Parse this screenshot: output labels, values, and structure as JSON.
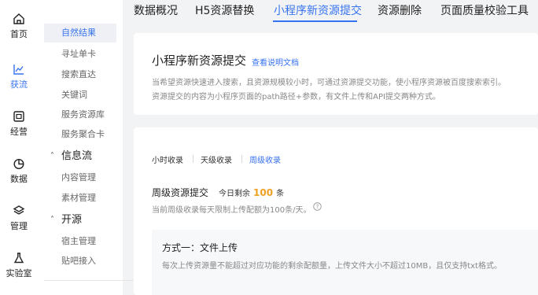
{
  "rail": {
    "items": [
      {
        "label": "首页",
        "icon": "home-icon"
      },
      {
        "label": "获流",
        "icon": "trend-chart-icon"
      },
      {
        "label": "经营",
        "icon": "operation-icon"
      },
      {
        "label": "数据",
        "icon": "pie-chart-icon"
      },
      {
        "label": "管理",
        "icon": "layers-icon"
      },
      {
        "label": "实验室",
        "icon": "flask-icon"
      }
    ],
    "active_color": "#3773f0"
  },
  "subnav": {
    "items": [
      {
        "label": "自然结果",
        "active": true
      },
      {
        "label": "寻址单卡"
      },
      {
        "label": "搜索直达"
      },
      {
        "label": "关键词"
      },
      {
        "label": "服务资源库"
      },
      {
        "label": "服务聚合卡"
      }
    ],
    "groups": [
      {
        "label": "信息流",
        "items": [
          "内容管理",
          "素材管理"
        ]
      },
      {
        "label": "开源",
        "items": [
          "宿主管理",
          "贴吧接入"
        ]
      }
    ]
  },
  "tabs": [
    {
      "label": "数据概况"
    },
    {
      "label": "H5资源替换"
    },
    {
      "label": "小程序新资源提交",
      "active": true
    },
    {
      "label": "资源删除"
    },
    {
      "label": "页面质量校验工具"
    }
  ],
  "intro": {
    "title": "小程序新资源提交",
    "doc_link": "查看说明文档",
    "desc_line1": "当希望资源快速进入搜索，且资源规模较小时，可通过资源提交功能，使小程序资源被百度搜索索引。",
    "desc_line2": "资源提交的内容为小程序页面的path路径+参数，有文件上传和API提交两种方式。"
  },
  "submit": {
    "freq_tabs": [
      "小时收录",
      "天级收录",
      "周级收录"
    ],
    "active_freq": "周级收录",
    "section_title": "周级资源提交",
    "remain_prefix": "今日剩余",
    "remain_value": "100",
    "remain_suffix": "条",
    "limit_text": "当前周级收录每天限制上传配额为100条/天。",
    "method_title": "方式一：文件上传",
    "method_desc": "每次上传资源量不能超过对应功能的剩余配额量，上传文件大小不超过10MB，且仅支持txt格式。"
  },
  "colors": {
    "accent": "#3773f0",
    "quota": "#f0a020"
  }
}
